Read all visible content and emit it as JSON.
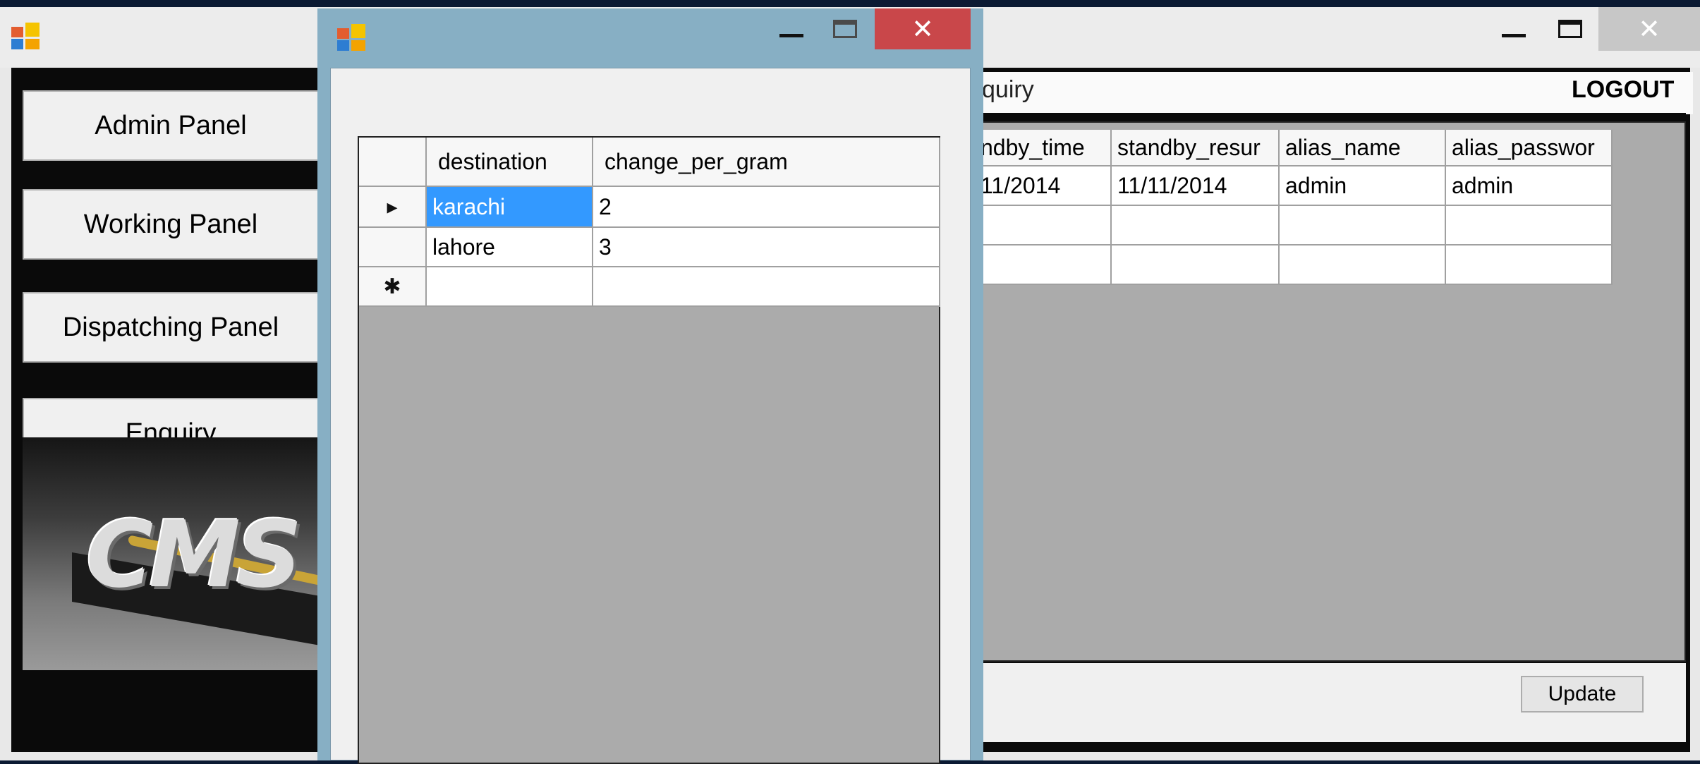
{
  "main_window": {
    "nav_buttons": [
      "Admin Panel",
      "Working Panel",
      "Dispatching Panel",
      "Enquiry"
    ],
    "logo_text": "CMS",
    "menu_item": "quiry",
    "logout_label": "LOGOUT",
    "grid": {
      "columns": [
        "ndby_time",
        "standby_resur",
        "alias_name",
        "alias_passwor"
      ],
      "rows": [
        [
          "11/2014",
          "11/11/2014",
          "admin",
          "admin"
        ],
        [
          "",
          "",
          "",
          ""
        ],
        [
          "",
          "",
          "",
          ""
        ]
      ]
    },
    "update_label": "Update"
  },
  "dialog": {
    "grid": {
      "columns": [
        "destination",
        "change_per_gram"
      ],
      "rows": [
        {
          "marker": "▸",
          "cells": [
            "karachi",
            "2"
          ],
          "selected": true
        },
        {
          "marker": "",
          "cells": [
            "lahore",
            "3"
          ],
          "selected": false
        },
        {
          "marker": "✱",
          "cells": [
            "",
            ""
          ],
          "selected": false
        }
      ]
    }
  },
  "colors": {
    "dialog_frame": "#87afc4",
    "close_active": "#c9474a",
    "selection": "#3399ff",
    "grid_background": "#ababab"
  }
}
